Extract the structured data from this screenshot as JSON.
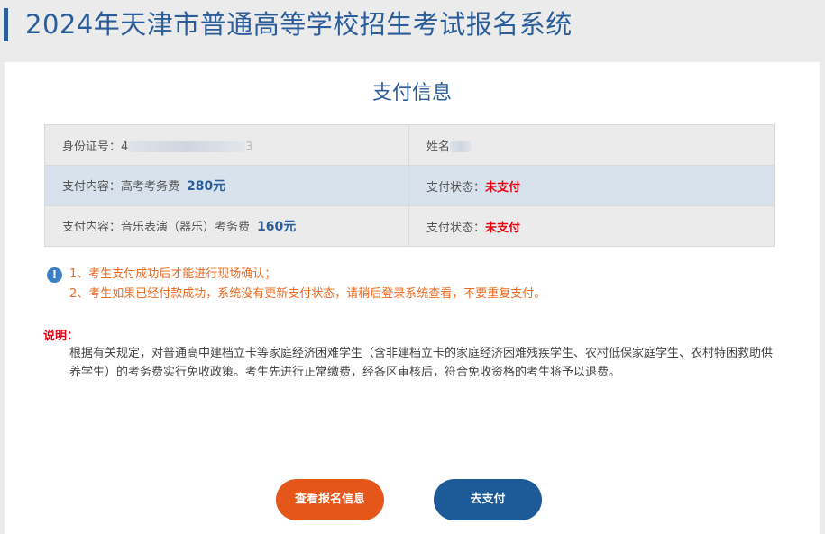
{
  "header": {
    "title": "2024年天津市普通高等学校招生考试报名系统"
  },
  "payment": {
    "title": "支付信息",
    "id_label": "身份证号：",
    "id_visible_start": "4",
    "id_visible_end": "3",
    "name_label": "姓名",
    "rows": [
      {
        "content_label": "支付内容：",
        "content_item": "高考考务费",
        "fee": "280元",
        "status_label": "支付状态：",
        "status_value": "未支付"
      },
      {
        "content_label": "支付内容：",
        "content_item": "音乐表演（器乐）考务费",
        "fee": "160元",
        "status_label": "支付状态：",
        "status_value": "未支付"
      }
    ]
  },
  "notice": {
    "icon": "info-icon",
    "lines": [
      "1、考生支付成功后才能进行现场确认；",
      "2、考生如果已经付款成功，系统没有更新支付状态，请稍后登录系统查看，不要重复支付。"
    ]
  },
  "description": {
    "label": "说明：",
    "text": "根据有关规定，对普通高中建档立卡等家庭经济困难学生（含非建档立卡的家庭经济困难残疾学生、农村低保家庭学生、农村特困救助供养学生）的考务费实行免收政策。考生先进行正常缴费，经各区审核后，符合免收资格的考生将予以退费。"
  },
  "buttons": {
    "view_info": "查看报名信息",
    "pay": "去支付"
  },
  "colors": {
    "brand_blue": "#2a5d9a",
    "orange": "#e4561a",
    "notice_orange": "#ee6a1f",
    "status_red": "#e60012"
  }
}
